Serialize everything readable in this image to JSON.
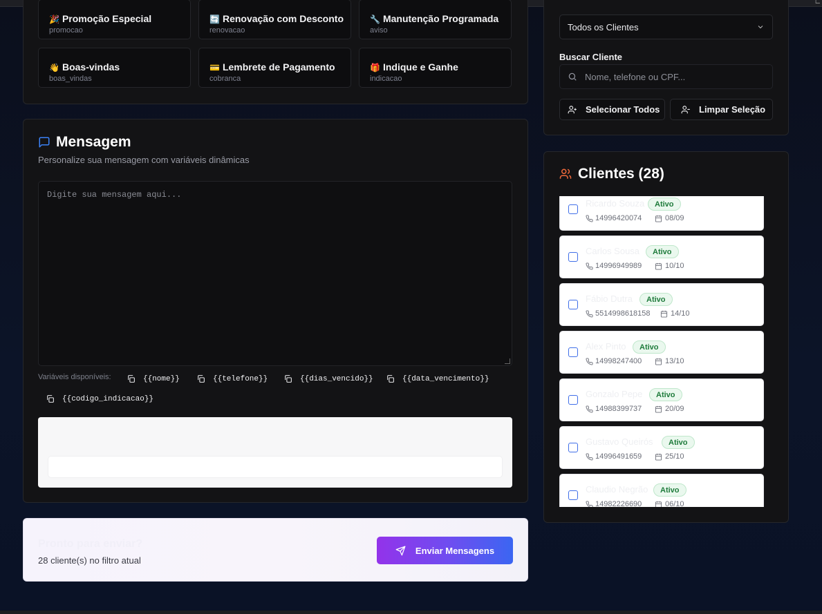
{
  "templates": [
    {
      "emoji": "🎉",
      "title": "Promoção Especial",
      "key": "promocao"
    },
    {
      "emoji": "🔄",
      "title": "Renovação com Desconto",
      "key": "renovacao"
    },
    {
      "emoji": "🔧",
      "title": "Manutenção Programada",
      "key": "aviso"
    },
    {
      "emoji": "👋",
      "title": "Boas-vindas",
      "key": "boas_vindas"
    },
    {
      "emoji": "💳",
      "title": "Lembrete de Pagamento",
      "key": "cobranca"
    },
    {
      "emoji": "🎁",
      "title": "Indique e Ganhe",
      "key": "indicacao"
    }
  ],
  "message": {
    "title": "Mensagem",
    "subtitle": "Personalize sua mensagem com variáveis dinâmicas",
    "placeholder": "Digite sua mensagem aqui...",
    "variables_label": "Variáveis disponíveis:",
    "variables": [
      "{{nome}}",
      "{{telefone}}",
      "{{dias_vencido}}",
      "{{data_vencimento}}",
      "{{codigo_indicacao}}"
    ]
  },
  "send": {
    "ready_text": "Pronto para enviar?",
    "count_text": "28 cliente(s) no filtro atual",
    "button_label": "Enviar Mensagens"
  },
  "filter": {
    "select_value": "Todos os Clientes",
    "search_label": "Buscar Cliente",
    "search_placeholder": "Nome, telefone ou CPF...",
    "select_all_label": "Selecionar Todos",
    "clear_label": "Limpar Seleção"
  },
  "clients": {
    "title": "Clientes (28)",
    "items": [
      {
        "name": "Ricardo Souza",
        "status": "Ativo",
        "phone": "14996420074",
        "date": "08/09"
      },
      {
        "name": "Carlos Sousa",
        "status": "Ativo",
        "phone": "14996949989",
        "date": "10/10"
      },
      {
        "name": "Fábio Dutra",
        "status": "Ativo",
        "phone": "5514998618158",
        "date": "14/10"
      },
      {
        "name": "Alex Pinto",
        "status": "Ativo",
        "phone": "14998247400",
        "date": "13/10"
      },
      {
        "name": "Gonzalo Pepe",
        "status": "Ativo",
        "phone": "14988399737",
        "date": "20/09"
      },
      {
        "name": "Gustavo Queirós",
        "status": "Ativo",
        "phone": "14996491659",
        "date": "25/10"
      },
      {
        "name": "Claudio Negrão",
        "status": "Ativo",
        "phone": "14982226690",
        "date": "06/10"
      }
    ]
  },
  "colors": {
    "accent_blue": "#3b66f2",
    "accent_purple": "#9333ea",
    "clients_icon": "#f26a3b",
    "status_green": "#1e7b3b"
  }
}
